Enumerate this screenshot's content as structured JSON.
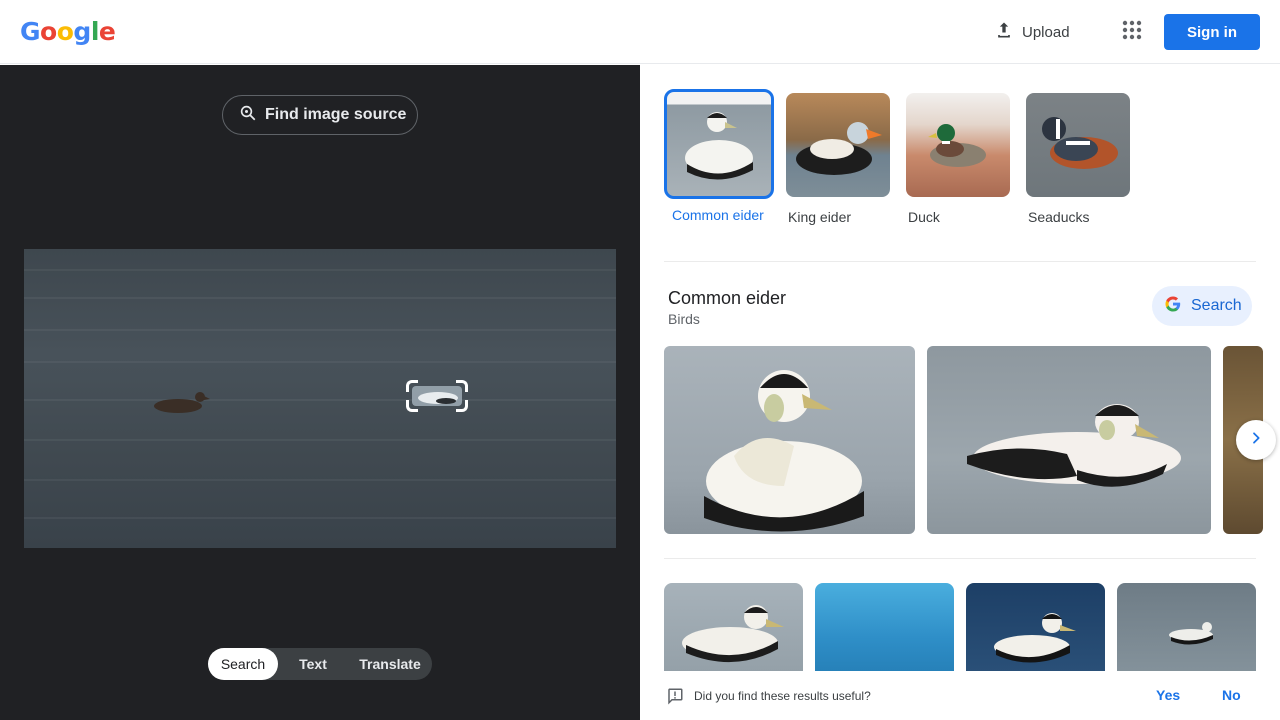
{
  "header": {
    "logo_letters": [
      {
        "char": "G",
        "color": "#4285f4"
      },
      {
        "char": "o",
        "color": "#ea4335"
      },
      {
        "char": "o",
        "color": "#fbbc05"
      },
      {
        "char": "g",
        "color": "#4285f4"
      },
      {
        "char": "l",
        "color": "#34a853"
      },
      {
        "char": "e",
        "color": "#ea4335"
      }
    ],
    "upload_label": "Upload",
    "upload_icon": "upload-icon",
    "apps_icon": "apps-grid-icon",
    "signin_label": "Sign in"
  },
  "left_panel": {
    "find_source_label": "Find image source",
    "find_source_icon": "image-search-icon",
    "modes": [
      {
        "label": "Search",
        "active": true
      },
      {
        "label": "Text",
        "active": false
      },
      {
        "label": "Translate",
        "active": false
      }
    ]
  },
  "results": {
    "chips": [
      {
        "label": "Common eider",
        "selected": true
      },
      {
        "label": "King eider",
        "selected": false
      },
      {
        "label": "Duck",
        "selected": false
      },
      {
        "label": "Seaducks",
        "selected": false
      }
    ],
    "entity": {
      "title": "Common eider",
      "subtitle": "Birds",
      "search_label": "Search",
      "search_icon": "google-g-icon"
    },
    "next_icon": "chevron-right-icon",
    "feedback": {
      "question": "Did you find these results useful?",
      "yes_label": "Yes",
      "no_label": "No",
      "icon": "feedback-icon"
    }
  },
  "colors": {
    "accent": "#1a73e8",
    "dark_panel": "#202124",
    "pill_bg": "#e8f0fe"
  }
}
